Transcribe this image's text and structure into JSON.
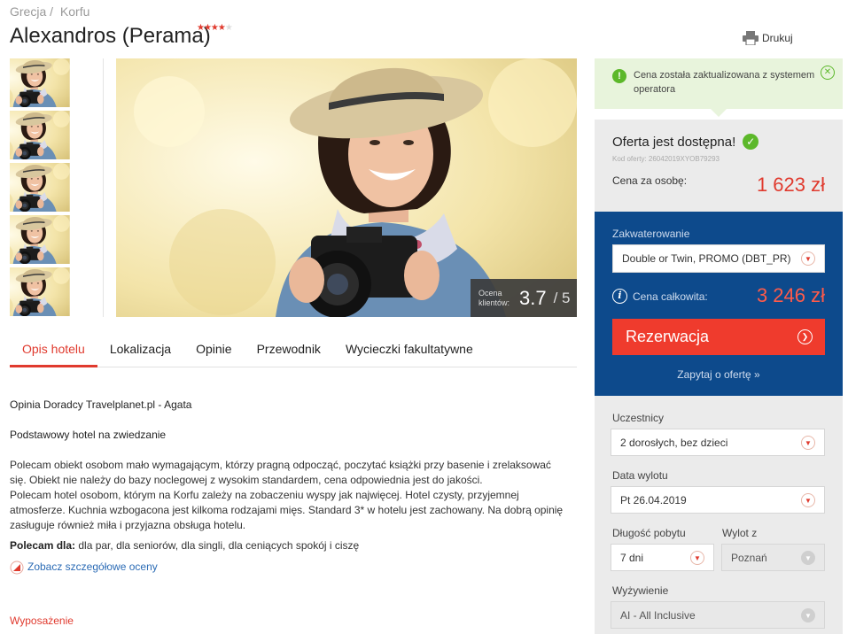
{
  "breadcrumb": {
    "country": "Grecja /",
    "region": "Korfu"
  },
  "hotel": {
    "name": "Alexandros (Perama)",
    "stars": "★★★★",
    "star_empty": "★"
  },
  "print": {
    "label": "Drukuj"
  },
  "rating": {
    "label": "Ocena klientów:",
    "value": "3.7",
    "max": "/ 5"
  },
  "tabs": [
    "Opis hotelu",
    "Lokalizacja",
    "Opinie",
    "Przewodnik",
    "Wycieczki fakultatywne"
  ],
  "content": {
    "advisor": "Opinia Doradcy Travelplanet.pl - Agata",
    "headline": "Podstawowy hotel na zwiedzanie",
    "p1": "Polecam obiekt osobom mało wymagającym, którzy pragną odpocząć, poczytać książki przy basenie i zrelaksować się. Obiekt nie należy do bazy noclegowej z wysokim standardem, cena odpowiednia jest do jakości.",
    "p2": "Polecam hotel osobom, którym na Korfu zależy na zobaczeniu wyspy jak najwięcej. Hotel czysty, przyjemnej atmosferze. Kuchnia wzbogacona jest kilkoma rodzajami mięs. Standard 3* w hotelu jest zachowany. Na dobrą opinię zasługuje również miła i przyjazna obsługa hotelu.",
    "recommend_label": "Polecam dla:",
    "recommend_value": " dla par, dla seniorów, dla singli, dla ceniących spokój i ciszę",
    "details_link": "Zobacz szczegółowe oceny",
    "equipment": "Wyposażenie"
  },
  "notice": {
    "text": "Cena została zaktualizowana z systemem operatora"
  },
  "offer": {
    "title": "Oferta jest dostępna!",
    "code": "Kod oferty: 26042019XYOB79293",
    "per_person_label": "Cena za osobę:",
    "per_person_value": "1 623 zł"
  },
  "booking": {
    "accommodation_label": "Zakwaterowanie",
    "accommodation_value": "Double or Twin, PROMO (DBT_PR)",
    "total_label": "Cena całkowita:",
    "total_value": "3 246 zł",
    "reserve_label": "Rezerwacja",
    "ask_label": "Zapytaj o ofertę »"
  },
  "params": {
    "participants_label": "Uczestnicy",
    "participants_value": "2 dorosłych, bez dzieci",
    "departure_label": "Data wylotu",
    "departure_value": "Pt 26.04.2019",
    "duration_label": "Długość pobytu",
    "duration_value": "7 dni",
    "from_label": "Wylot z",
    "from_value": "Poznań",
    "board_label": "Wyżywienie",
    "board_value": "AI - All Inclusive"
  },
  "colors": {
    "accent": "#e03a2e",
    "brand_blue": "#0d4a8c",
    "success": "#5cb82a"
  },
  "icons": [
    "printer-icon",
    "exclamation-icon",
    "close-icon",
    "check-icon",
    "info-icon",
    "arrow-right-icon",
    "chevron-down-icon",
    "chart-icon"
  ]
}
